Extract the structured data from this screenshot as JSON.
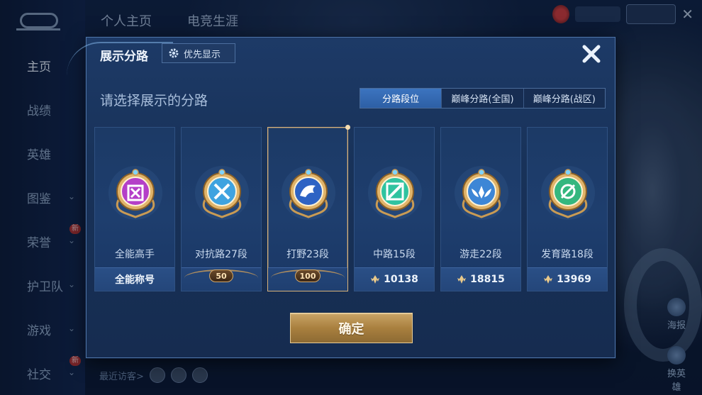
{
  "nav": {
    "items": [
      {
        "label": "主页",
        "chevron": false,
        "new": false,
        "active": true
      },
      {
        "label": "战绩",
        "chevron": false,
        "new": false,
        "active": false
      },
      {
        "label": "英雄",
        "chevron": false,
        "new": false,
        "active": false
      },
      {
        "label": "图鉴",
        "chevron": true,
        "new": false,
        "active": false
      },
      {
        "label": "荣誉",
        "chevron": true,
        "new": true,
        "active": false
      },
      {
        "label": "护卫队",
        "chevron": true,
        "new": false,
        "active": false
      },
      {
        "label": "游戏",
        "chevron": true,
        "new": false,
        "active": false
      },
      {
        "label": "社交",
        "chevron": true,
        "new": true,
        "active": false
      }
    ],
    "new_tag": "新"
  },
  "top_tabs": [
    "个人主页",
    "电竞生涯"
  ],
  "recent_visitors_label": "最近访客>",
  "right_icons": [
    "海报",
    "换英雄"
  ],
  "dialog": {
    "title": "展示分路",
    "pref_button": "优先显示",
    "prompt": "请选择展示的分路",
    "segments": [
      "分路段位",
      "巅峰分路(全国)",
      "巅峰分路(战区)"
    ],
    "confirm": "确定"
  },
  "cards": [
    {
      "name": "全能高手",
      "foot": "全能称号",
      "foot_type": "text",
      "emblem": "purple-emblem",
      "color": "#b43fc8"
    },
    {
      "name": "对抗路27段",
      "foot": "50",
      "foot_type": "badge",
      "emblem": "sword-cross-emblem",
      "color": "#3fa3e0"
    },
    {
      "name": "打野23段",
      "foot": "100",
      "foot_type": "badge",
      "emblem": "dragon-emblem",
      "color": "#2e63c4",
      "selected": true
    },
    {
      "name": "中路15段",
      "foot": "10138",
      "foot_type": "points",
      "emblem": "slash-emblem",
      "color": "#2fc3a0"
    },
    {
      "name": "游走22段",
      "foot": "18815",
      "foot_type": "points",
      "emblem": "wings-emblem",
      "color": "#3d86d6"
    },
    {
      "name": "发育路18段",
      "foot": "13969",
      "foot_type": "points",
      "emblem": "target-emblem",
      "color": "#34b77f"
    }
  ]
}
